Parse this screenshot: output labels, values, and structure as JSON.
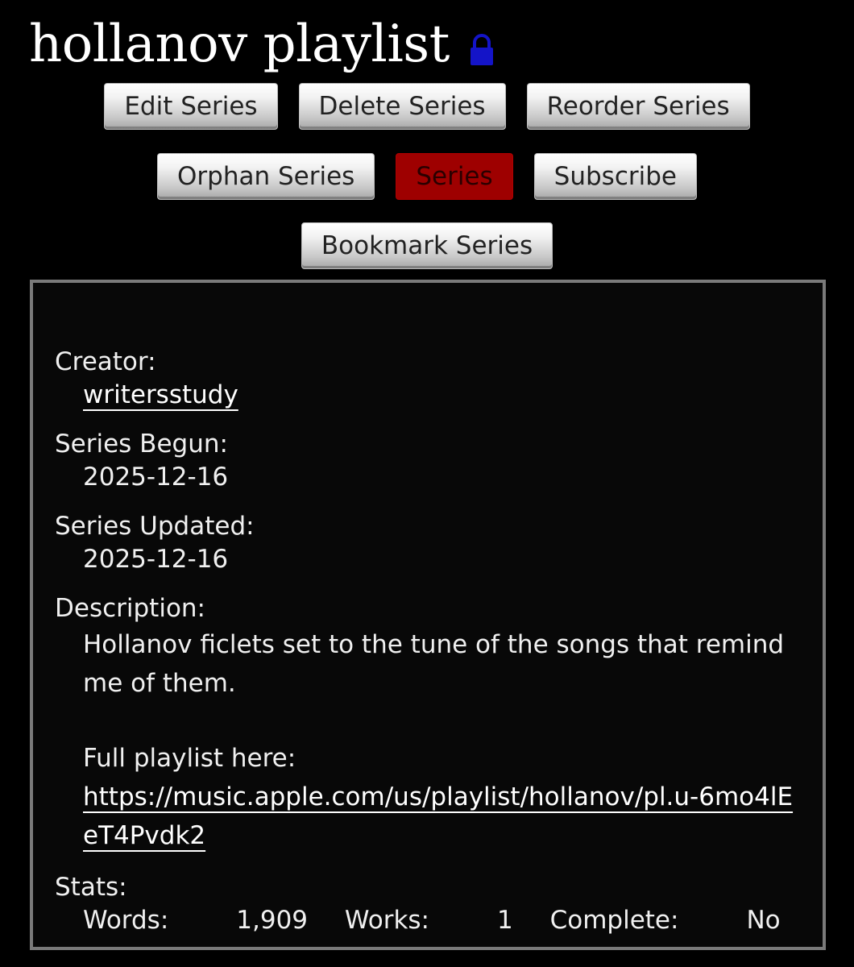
{
  "header": {
    "title": "hollanov playlist",
    "lock_icon": "lock-icon",
    "lock_color": "#1414c8"
  },
  "actions": {
    "edit": "Edit Series",
    "delete": "Delete Series",
    "reorder": "Reorder Series",
    "orphan": "Orphan Series",
    "series": "Series",
    "subscribe": "Subscribe",
    "bookmark": "Bookmark Series",
    "active_color": "#9e0000"
  },
  "meta": {
    "creator_label": "Creator:",
    "creator": "writersstudy",
    "begun_label": "Series Begun:",
    "begun": "2025-12-16",
    "updated_label": "Series Updated:",
    "updated": "2025-12-16",
    "description_label": "Description:",
    "description_p1": "Hollanov ficlets set to the tune of the songs that remind me of them.",
    "description_p2_text": "Full playlist here:",
    "description_link": "https://music.apple.com/us/playlist/hollanov/pl.u-6mo4lEeT4Pvdk2",
    "stats_label": "Stats:",
    "words_label": "Words:",
    "words": "1,909",
    "works_label": "Works:",
    "works": "1",
    "complete_label": "Complete:",
    "complete": "No"
  }
}
